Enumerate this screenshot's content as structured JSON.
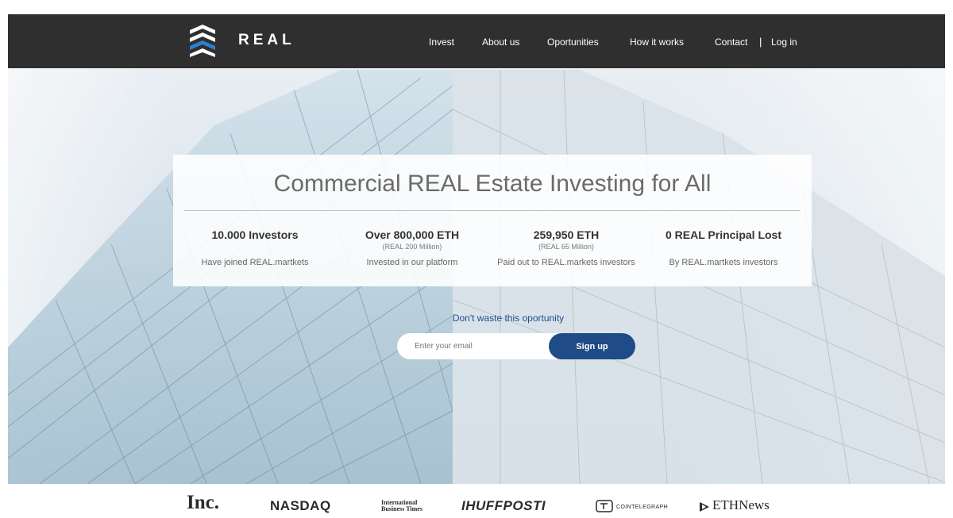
{
  "header": {
    "brand": "REAL",
    "nav": [
      {
        "label": "Invest"
      },
      {
        "label": "About us"
      },
      {
        "label": "Oportunities"
      },
      {
        "label": "How it works"
      },
      {
        "label": "Contact"
      }
    ],
    "separator": "|",
    "login": "Log in"
  },
  "hero": {
    "title": "Commercial REAL Estate Investing for All",
    "stats": [
      {
        "head": "10.000 Investors",
        "sub": "",
        "desc": "Have joined REAL.martkets"
      },
      {
        "head": "Over 800,000 ETH",
        "sub": "(REAL 200 Million)",
        "desc": "Invested in our platform"
      },
      {
        "head": "259,950 ETH",
        "sub": "(REAL 65 Million)",
        "desc": "Paid out to REAL.markets investors"
      },
      {
        "head": "0 REAL Principal Lost",
        "sub": "",
        "desc": "By REAL.martkets investors"
      }
    ]
  },
  "cta": {
    "text": "Don't waste this oportunity",
    "email_placeholder": "Enter your email",
    "signup_label": "Sign up"
  },
  "press": {
    "inc": "Inc.",
    "nasdaq": "NASDAQ",
    "ibt": "International Business Times",
    "huffpost": "IHUFFPOSTI",
    "cointelegraph": "COINTELEGRAPH",
    "ethnews": "ETHNews"
  },
  "colors": {
    "topbar": "#2f2f2f",
    "accent": "#1f4b86",
    "cta_text": "#1c4f8c"
  }
}
